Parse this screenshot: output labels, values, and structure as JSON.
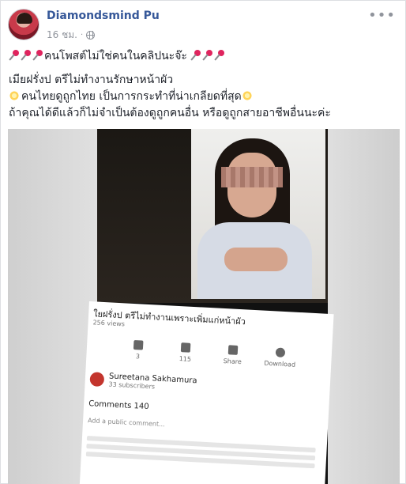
{
  "post": {
    "author": "Diamondsmind Pu",
    "time": "16 ชม.",
    "privacy_icon": "globe-icon",
    "more_icon": "more-options-icon",
    "headline": "คนโพสต์ไม่ใช่คนในคลิปนะจ๊ะ",
    "line2": "เมียฝรั่งป ตรีไม่ทำงานรักษาหน้าผัว",
    "line3": "คนไทยดูถูกไทย เป็นการกระทำที่น่าเกลียดที่สุด",
    "line4": "ถ้าคุณได้ดีแล้วก็ไม่จำเป็นต้องดูถูกคนอื่น หรือดูถูกสายอาชีพอื่นนะค่ะ"
  },
  "video_screen": {
    "title": "ใยฝรั่งป ตรีไม่ทำงานเพราะเพิ่มแก่หน้าผัว",
    "views": "256 views",
    "like_count": "3",
    "dislike_count": "115",
    "share_label": "Share",
    "download_label": "Download",
    "channel_name": "Sureetana Sakhamura",
    "subscribers": "33 subscribers",
    "comments_label": "Comments",
    "comments_count": "140",
    "add_comment_placeholder": "Add a public comment..."
  },
  "colors": {
    "author_link": "#365899",
    "meta_gray": "#90949c",
    "text": "#1d2129"
  }
}
